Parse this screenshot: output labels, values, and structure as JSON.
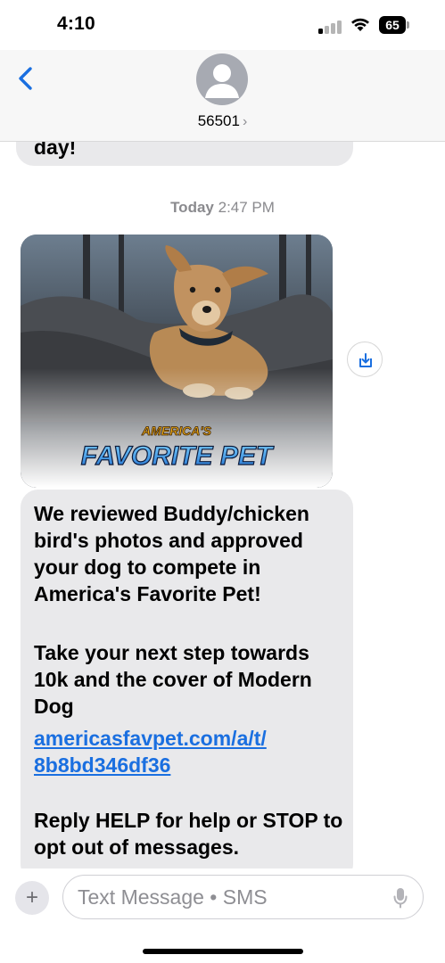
{
  "status_bar": {
    "time": "4:10",
    "battery": "65",
    "battery_level": 0.65,
    "signal_bars_on": 1
  },
  "header": {
    "contact": "56501",
    "chevron": "›"
  },
  "thread": {
    "previous_message_tail": "day!",
    "timestamp_day": "Today",
    "timestamp_time": "2:47 PM",
    "image": {
      "logo_line1": "AMERICA'S",
      "logo_line2": "FAVORITE PET"
    },
    "message": {
      "paragraph1": "We reviewed Buddy/chicken bird's photos and approved your dog to compete in America's Favorite Pet!",
      "paragraph2": "Take your next step towards 10k and the cover of Modern Dog",
      "link_line1": "americasfavpet.com/a/t/",
      "link_line2": "8b8bd346df36",
      "paragraph3": "Reply HELP for help or STOP to opt out of messages."
    }
  },
  "compose": {
    "placeholder": "Text Message • SMS",
    "plus": "+"
  },
  "colors": {
    "accent": "#1a6fe0",
    "bubble": "#e9e9eb",
    "header_bg": "#f7f7f7"
  },
  "icons": [
    "back-chevron-icon",
    "avatar-icon",
    "save-icon",
    "plus-icon",
    "mic-icon",
    "wifi-icon",
    "signal-icon",
    "battery-icon"
  ]
}
